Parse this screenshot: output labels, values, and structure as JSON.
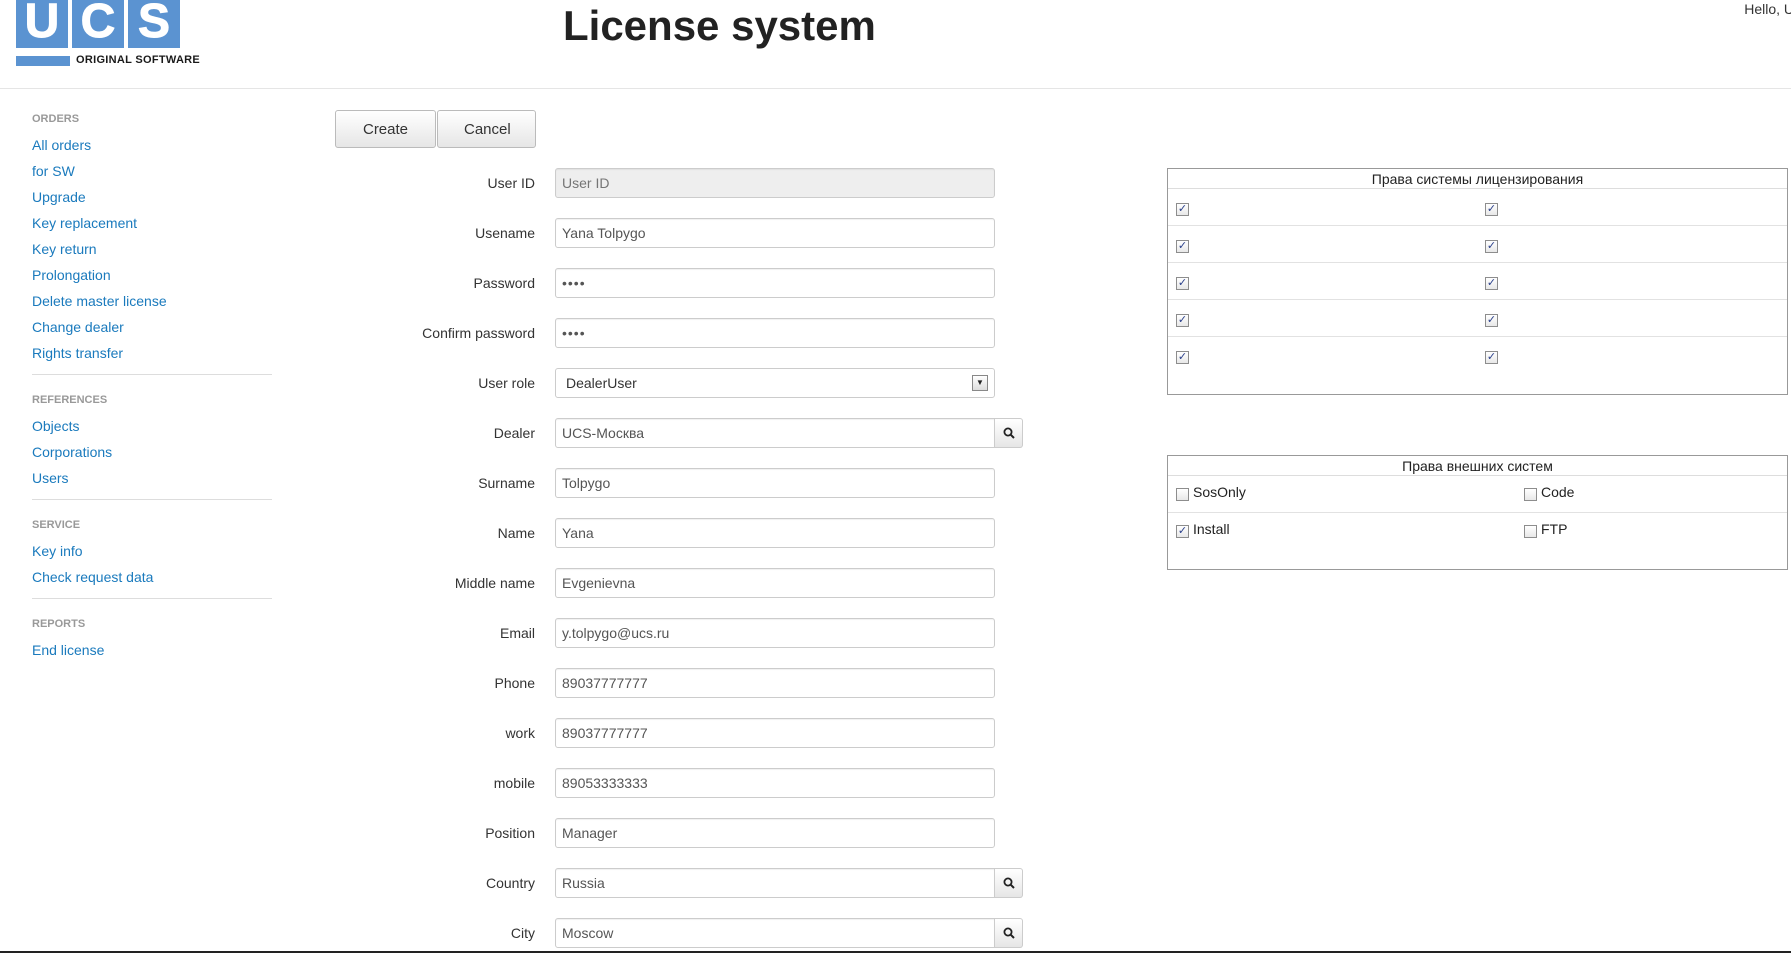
{
  "header": {
    "logo_letters": [
      "U",
      "C",
      "S"
    ],
    "logo_subtitle": "ORIGINAL SOFTWARE",
    "title": "License system",
    "greeting": "Hello, U"
  },
  "sidebar": {
    "groups": [
      {
        "header": "ORDERS",
        "items": [
          "All orders",
          "for SW",
          "Upgrade",
          "Key replacement",
          "Key return",
          "Prolongation",
          "Delete master license",
          "Change dealer",
          "Rights transfer"
        ]
      },
      {
        "header": "REFERENCES",
        "items": [
          "Objects",
          "Corporations",
          "Users"
        ]
      },
      {
        "header": "SERVICE",
        "items": [
          "Key info",
          "Check request data"
        ]
      },
      {
        "header": "REPORTS",
        "items": [
          "End license"
        ]
      }
    ]
  },
  "toolbar": {
    "create_label": "Create",
    "cancel_label": "Cancel"
  },
  "form": {
    "user_id": {
      "label": "User ID",
      "value": "",
      "placeholder": "User ID"
    },
    "username": {
      "label": "Usename",
      "value": "Yana Tolpygo"
    },
    "password": {
      "label": "Password",
      "value": "1234"
    },
    "confirm_password": {
      "label": "Confirm password",
      "value": "1234"
    },
    "user_role": {
      "label": "User role",
      "value": "DealerUser"
    },
    "dealer": {
      "label": "Dealer",
      "value": "UCS-Москва"
    },
    "surname": {
      "label": "Surname",
      "value": "Tolpygo"
    },
    "name": {
      "label": "Name",
      "value": "Yana"
    },
    "middle_name": {
      "label": "Middle name",
      "value": "Evgenievna"
    },
    "email": {
      "label": "Email",
      "value": "y.tolpygo@ucs.ru"
    },
    "phone": {
      "label": "Phone",
      "value": "89037777777"
    },
    "work": {
      "label": "work",
      "value": "89037777777"
    },
    "mobile": {
      "label": "mobile",
      "value": "89053333333"
    },
    "position": {
      "label": "Position",
      "value": "Manager"
    },
    "country": {
      "label": "Country",
      "value": "Russia"
    },
    "city": {
      "label": "City",
      "value": "Moscow"
    }
  },
  "license_rights": {
    "title": "Права системы лицензирования",
    "rows": [
      [
        true,
        true
      ],
      [
        true,
        true
      ],
      [
        true,
        true
      ],
      [
        true,
        true
      ],
      [
        true,
        true
      ]
    ]
  },
  "external_rights": {
    "title": "Права внешних систем",
    "items": [
      {
        "label": "SosOnly",
        "checked": false
      },
      {
        "label": "Code",
        "checked": false
      },
      {
        "label": "Install",
        "checked": true
      },
      {
        "label": "FTP",
        "checked": false
      }
    ]
  },
  "icons": {
    "search": "search-icon",
    "dropdown": "chevron-down-icon",
    "check": "checkmark"
  },
  "colors": {
    "link": "#1a7abd",
    "brand": "#5b93d1",
    "nav_header": "#999999"
  }
}
